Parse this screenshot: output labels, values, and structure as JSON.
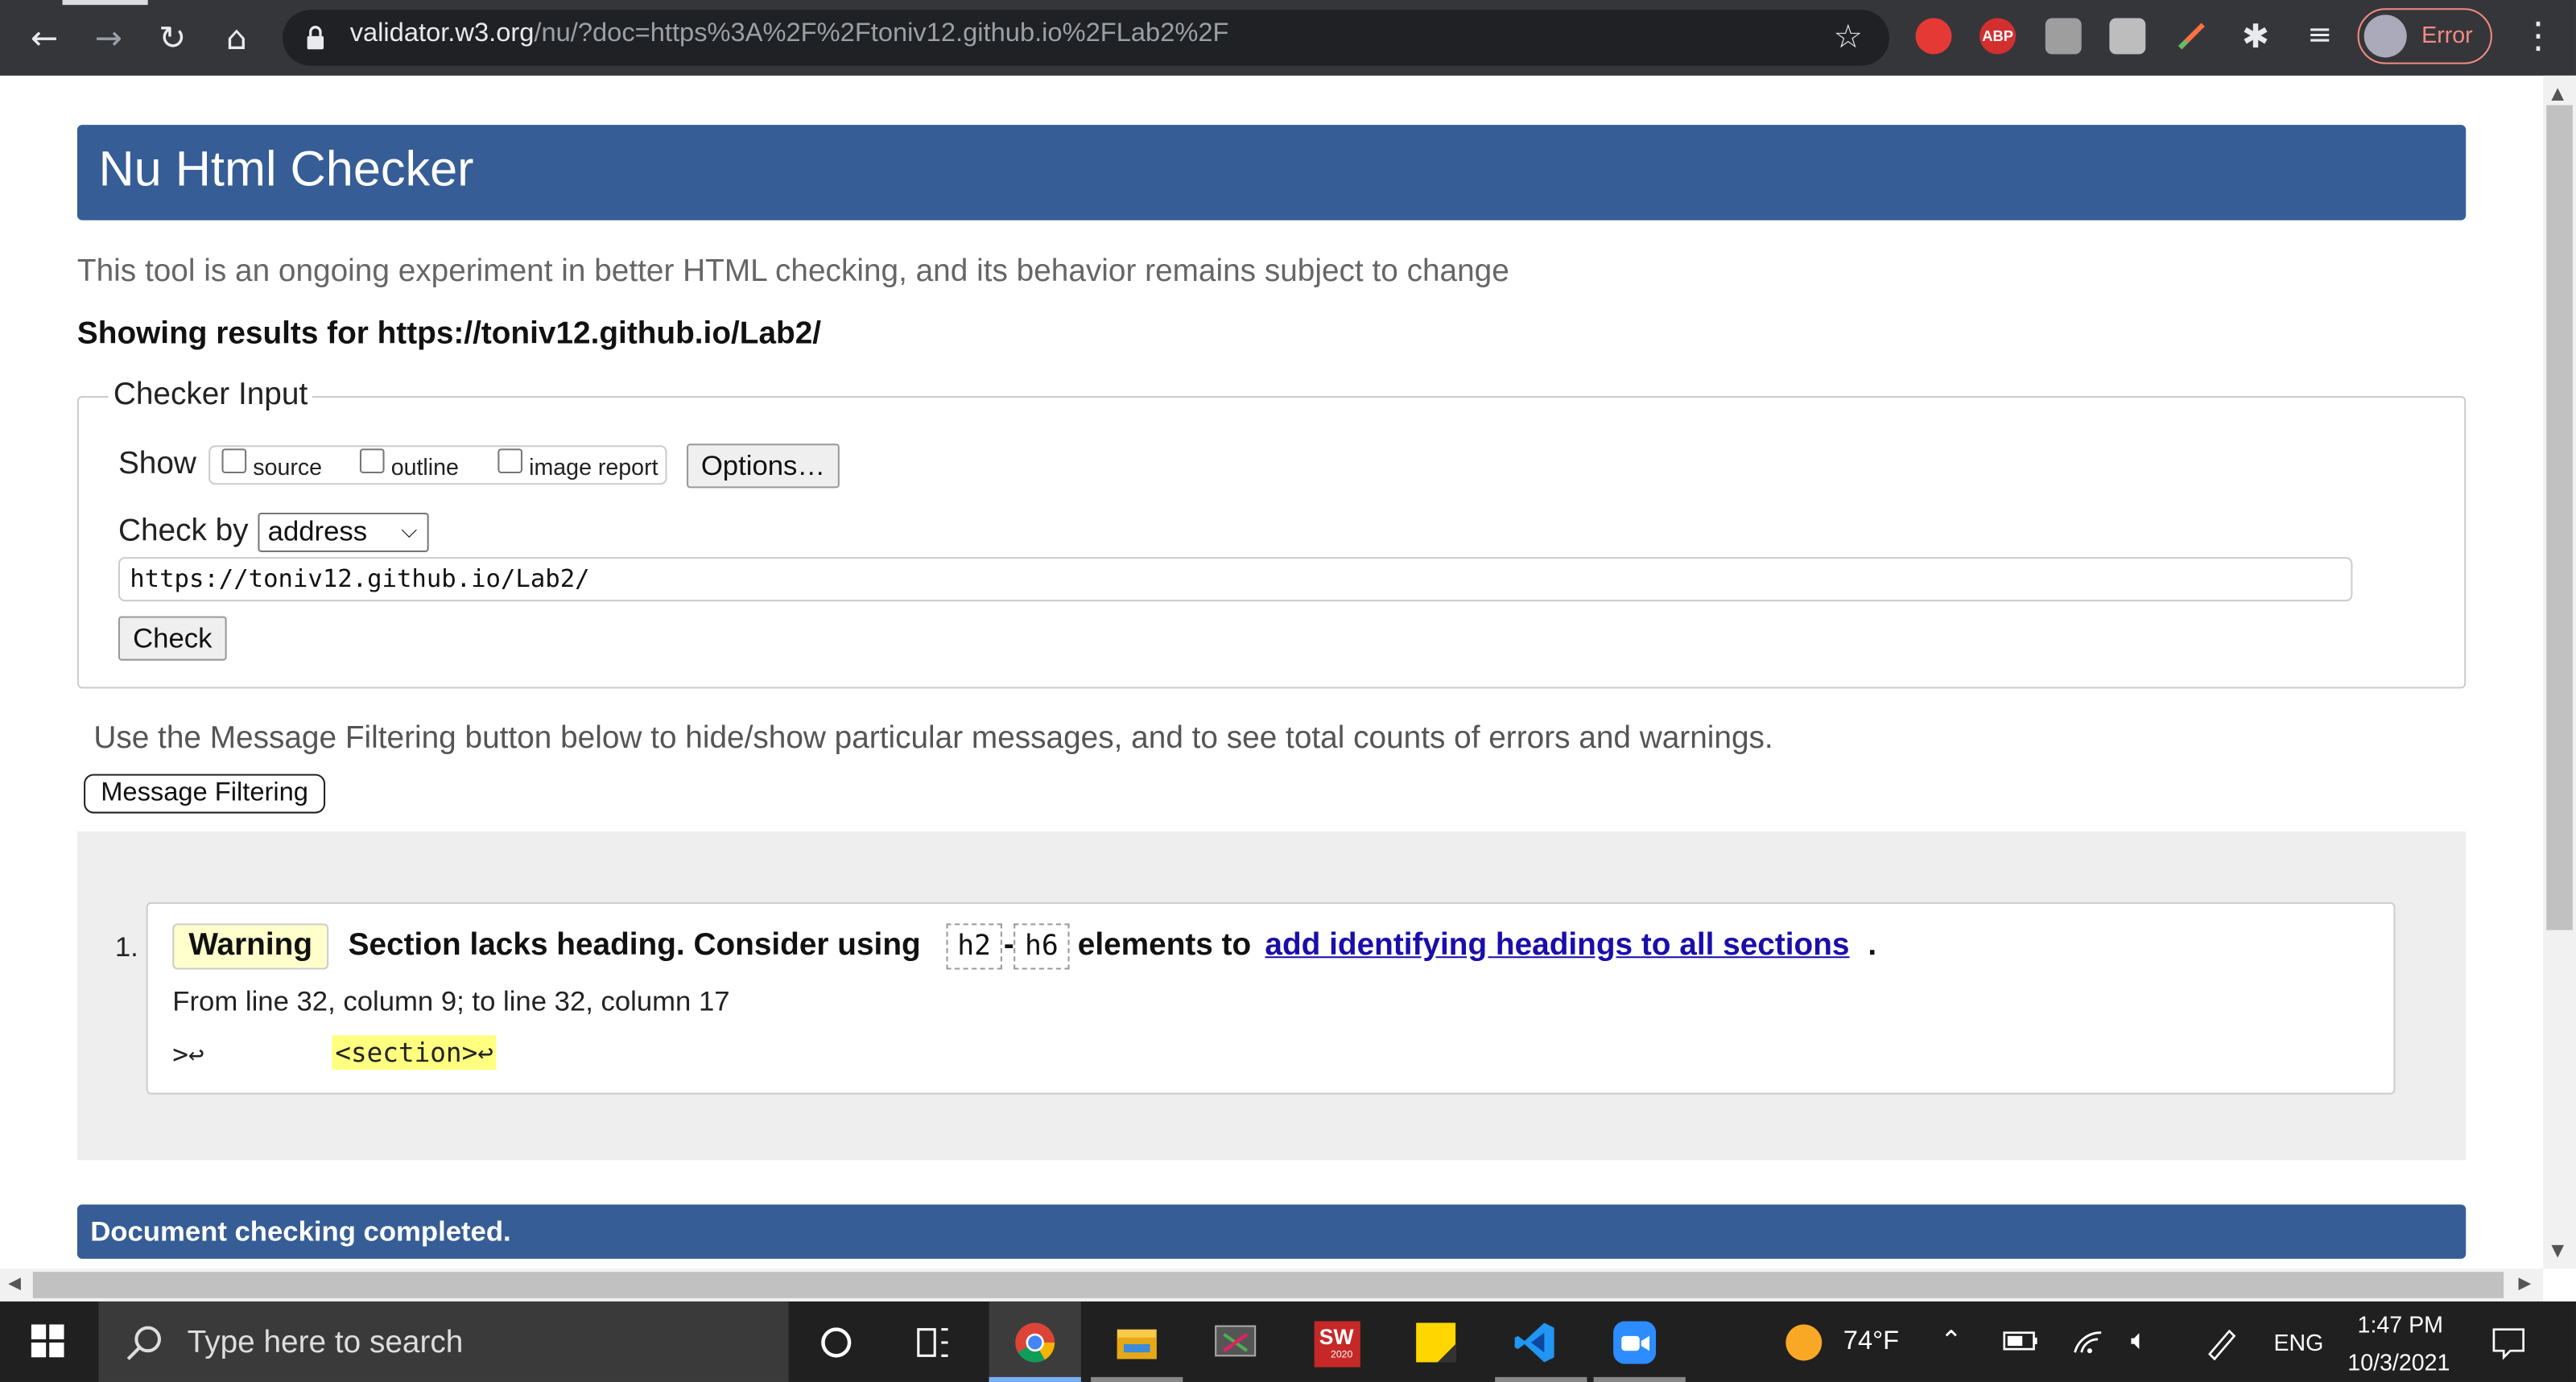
{
  "browser": {
    "url_host": "validator.w3.org",
    "url_path": "/nu/?doc=https%3A%2F%2Ftoniv12.github.io%2FLab2%2F",
    "profile_label": "Error",
    "extensions": [
      "abp-icon"
    ]
  },
  "page": {
    "title": "Nu Html Checker",
    "intro": "This tool is an ongoing experiment in better HTML checking, and its behavior remains subject to change",
    "results_for": "Showing results for https://toniv12.github.io/Lab2/"
  },
  "checker_input": {
    "legend": "Checker Input",
    "show_label": "Show",
    "options": [
      "source",
      "outline",
      "image report"
    ],
    "options_button": "Options…",
    "check_by_label": "Check by",
    "check_by_value": "address",
    "url_value": "https://toniv12.github.io/Lab2/",
    "check_button": "Check"
  },
  "filtering": {
    "info": "Use the Message Filtering button below to hide/show particular messages, and to see total counts of errors and warnings.",
    "button": "Message Filtering"
  },
  "messages": [
    {
      "number": "1.",
      "type": "Warning",
      "text_before": "Section lacks heading. Consider using",
      "code1": "h2",
      "dash": "-",
      "code2": "h6",
      "text_mid": "elements to",
      "link": "add identifying headings to all sections",
      "text_after": ".",
      "location": "From line 32, column 9; to line 32, column 17",
      "extract_before": ">↩",
      "extract_highlight": "<section>↩"
    }
  ],
  "footer": {
    "status": "Document checking completed."
  },
  "taskbar": {
    "search_placeholder": "Type here to search",
    "weather": "74°F",
    "language": "ENG",
    "time": "1:47 PM",
    "date": "10/3/2021",
    "sw_label": "SW",
    "sw_year": "2020"
  }
}
